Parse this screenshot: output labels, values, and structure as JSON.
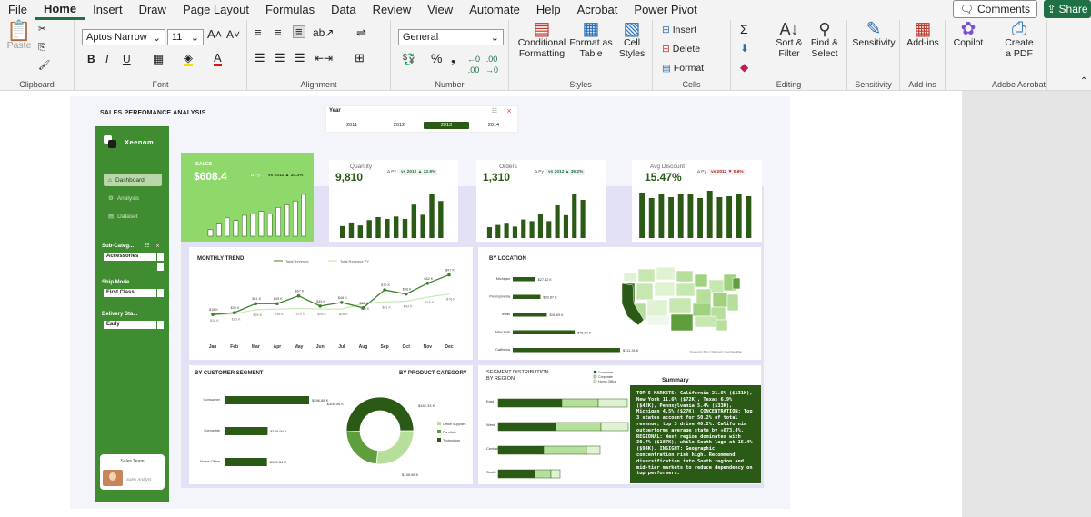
{
  "menubar": {
    "items": [
      "File",
      "Home",
      "Insert",
      "Draw",
      "Page Layout",
      "Formulas",
      "Data",
      "Review",
      "View",
      "Automate",
      "Help",
      "Acrobat",
      "Power Pivot"
    ],
    "active": "Home",
    "comments": "Comments",
    "share": "Share"
  },
  "ribbon": {
    "clipboard": {
      "label": "Clipboard",
      "paste": "Paste"
    },
    "font": {
      "label": "Font",
      "name": "Aptos Narrow",
      "size": "11"
    },
    "alignment": {
      "label": "Alignment"
    },
    "number": {
      "label": "Number",
      "format": "General"
    },
    "styles": {
      "label": "Styles",
      "cond1": "Conditional",
      "cond2": "Formatting",
      "fmt1": "Format as",
      "fmt2": "Table",
      "cell1": "Cell",
      "cell2": "Styles"
    },
    "cells": {
      "label": "Cells",
      "insert": "Insert",
      "delete": "Delete",
      "format": "Format"
    },
    "editing": {
      "label": "Editing",
      "sort1": "Sort &",
      "sort2": "Filter",
      "find1": "Find &",
      "find2": "Select"
    },
    "sensitivity": {
      "label": "Sensitivity",
      "btn": "Sensitivity"
    },
    "addins": {
      "label": "Add-ins",
      "btn": "Add-ins"
    },
    "copilot": {
      "btn": "Copilot"
    },
    "acrobat": {
      "label": "Adobe Acrobat",
      "btn1": "Create",
      "btn2": "a PDF"
    }
  },
  "dashboard": {
    "title": "SALES PERFOMANCE ANALYSIS",
    "year_slicer": {
      "title": "Year",
      "options": [
        "2011",
        "2012",
        "2013",
        "2014"
      ],
      "selected": "2013"
    },
    "sidebar": {
      "brand": "Xeenom",
      "nav": [
        "Dashboard",
        "Analysis",
        "Dataset"
      ],
      "slicers": [
        {
          "title": "Sub-Categ...",
          "value": "Accessories"
        },
        {
          "title": "Ship Mode",
          "value": "First Class"
        },
        {
          "title": "Delivery Sta...",
          "value": "Early"
        }
      ],
      "user": {
        "label": "Sales Team",
        "role": "Sales Analyst"
      }
    },
    "kpis": [
      {
        "title": "SALES",
        "value": "$608.4",
        "py": "Δ Py :",
        "delta": "vs 2012 ▲ 20.3%",
        "dir": "up",
        "bars": [
          1,
          2,
          2.8,
          2.4,
          3.2,
          3.4,
          3.8,
          3.4,
          4.4,
          4.8,
          5.4,
          6.4
        ]
      },
      {
        "title": "Quantity",
        "value": "9,810",
        "py": "Δ Py :",
        "delta": "vs 2012 ▲ 22.9%",
        "dir": "up",
        "bars": [
          2,
          2.6,
          2.1,
          3,
          3.5,
          3.2,
          3.6,
          3.2,
          5.6,
          3.9,
          7.3,
          6.2
        ]
      },
      {
        "title": "Orders",
        "value": "1,310",
        "py": "Δ Py :",
        "delta": "vs 2012 ▲ 36.2%",
        "dir": "up",
        "bars": [
          2,
          2.4,
          2.8,
          2.1,
          3.4,
          3.1,
          4.4,
          3.1,
          6,
          4.2,
          8,
          7
        ]
      },
      {
        "title": "Avg Discount",
        "value": "15.47%",
        "py": "Δ Py :",
        "delta": "vs 2012 ▼ 0.6%",
        "dir": "down",
        "bars": [
          5,
          4.4,
          4.9,
          4.5,
          4.9,
          4.8,
          4.4,
          5.2,
          4.5,
          4.6,
          4.8,
          4.6
        ]
      }
    ],
    "monthly": {
      "title": "MONTHLY TREND",
      "legend": [
        "Total Revenue",
        "Total Revenue PY"
      ],
      "months": [
        "Jan",
        "Feb",
        "Mar",
        "Apr",
        "May",
        "Jun",
        "Jul",
        "Aug",
        "Sep",
        "Oct",
        "Nov",
        "Dec"
      ],
      "labels": [
        "$18 K",
        "$30 K",
        "$51 K",
        "$49 K",
        "$67 K",
        "$45 K",
        "$48 K",
        "$51 K",
        "$72 K",
        "$66 K",
        "$82 K",
        "$97 K"
      ],
      "labels_py": [
        "$18 K",
        "$23 K",
        "$26 K",
        "$36 K",
        "$26 K",
        "$26 K",
        "$26 K",
        "$50 K",
        "$61 K",
        "$43 K",
        "$76 K",
        "$76 K"
      ],
      "cy": [
        18,
        21,
        36,
        36,
        49,
        32,
        38,
        29,
        59,
        52,
        70,
        84
      ],
      "py": [
        17,
        19,
        26,
        27,
        28,
        27,
        27,
        36,
        39,
        40,
        47,
        52
      ]
    },
    "location": {
      "title": "BY LOCATION",
      "states": [
        "Michigan",
        "Pennsylvania",
        "Texas",
        "New York",
        "California"
      ],
      "values": [
        27.42,
        33.87,
        41.69,
        75.84,
        131.31
      ],
      "labels": [
        "$27.42 K",
        "$33.87 K",
        "$41.69 K",
        "$75.84 K",
        "$131.31 K"
      ],
      "map_credit": "Powered by Bing © Microsoft, OpenStreetMap"
    },
    "segment": {
      "title": "BY CUSTOMER SEGMENT",
      "names": [
        "Consumer",
        "Corporate",
        "Home Office"
      ],
      "values": [
        296.88,
        106.94,
        105.34
      ],
      "labels": [
        "$296.88 K",
        "$106.94 K",
        "$105.34 K"
      ]
    },
    "product": {
      "title": "BY PRODUCT CATEGORY",
      "legend": [
        "Office Supplies",
        "Furniture",
        "Technology"
      ],
      "values": [
        162.33,
        138.98,
        306.06
      ],
      "labels": [
        "$162.33 K",
        "$138.98 K",
        "$306.06 K"
      ]
    },
    "region": {
      "title": "SEGMENT DISTRIBUTION BY REGION",
      "legend": [
        "Consumer",
        "Corporate",
        "Home Office"
      ],
      "regions": [
        "East",
        "West",
        "Central",
        "South"
      ],
      "consumer": [
        70,
        63,
        50,
        40
      ],
      "corporate": [
        40,
        50,
        47,
        18
      ],
      "home": [
        32,
        30,
        15,
        10
      ]
    },
    "summary": {
      "title": "Summary",
      "text": "TOP 5 MARKETS: California 21.6% ($131K), New York 11.6% ($72K), Texas 6.9% ($42K), Pennsylvania 5.4% ($33K), Michigan 4.5% ($27K). CONCENTRATION: Top 3 states account for 50.2% of total revenue, top 3 drive 40.2%. California outperforms average state by +873.4%. REGIONAL: West region dominates with 30.7% ($187K), while South lags at 15.4% ($94K). INSIGHT: Geographic concentration risk high. Recommend diversification into South region and mid-tier markets to reduce dependency on top performers."
    }
  },
  "colors": {
    "dark": "#2b5a16",
    "mid": "#5f9e3d",
    "light": "#b7df9c",
    "lighter": "#dff2d2",
    "sidebar": "#3f8c31",
    "kpi_highlight": "#8fd86b"
  }
}
